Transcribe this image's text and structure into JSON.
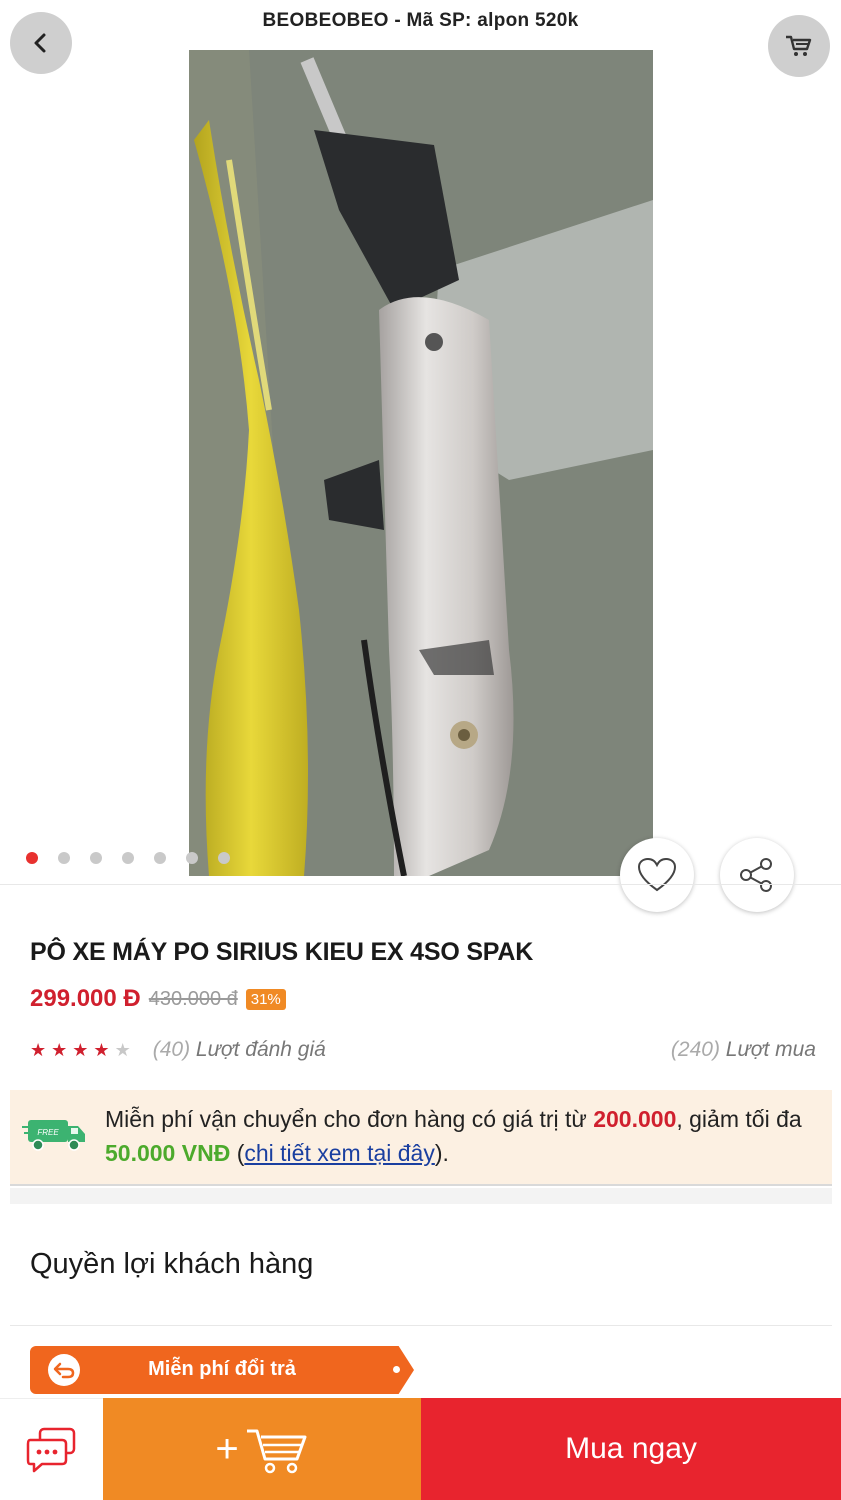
{
  "header": {
    "title": "BEOBEOBEO - Mã SP: alpon 520k"
  },
  "gallery": {
    "active_index": 0
  },
  "product": {
    "name": "PÔ XE MÁY PO SIRIUS KIEU EX 4SO SPAK",
    "price": "299.000 Đ",
    "old_price": "430.000 đ",
    "discount": "31%",
    "rating": 4,
    "rating_max": 5,
    "review_count": "40",
    "review_label": "Lượt đánh giá",
    "purchase_count": "240",
    "purchase_label": "Lượt mua"
  },
  "shipping": {
    "text_1": "Miễn phí vận chuyển cho đơn hàng có giá trị từ ",
    "min_value": "200.000",
    "text_2": ", giảm tối đa ",
    "max_discount": "50.000 VNĐ",
    "text_3": " (",
    "link": "chi tiết xem tại đây",
    "text_4": ").",
    "badge": "FREE"
  },
  "benefits": {
    "title": "Quyền lợi khách hàng",
    "chip_label": "Miễn phí đổi trả"
  },
  "bottom_bar": {
    "add_cart_plus": "+",
    "buy_label": "Mua ngay"
  },
  "colors": {
    "brand_red": "#e8242e",
    "brand_orange": "#f08a24",
    "price_red": "#d0202e",
    "green": "#4caa2c"
  },
  "icons": [
    "back-icon",
    "cart-icon",
    "heart-icon",
    "share-icon",
    "truck-icon",
    "return-icon",
    "chat-icon",
    "add-cart-icon",
    "star-icon"
  ]
}
